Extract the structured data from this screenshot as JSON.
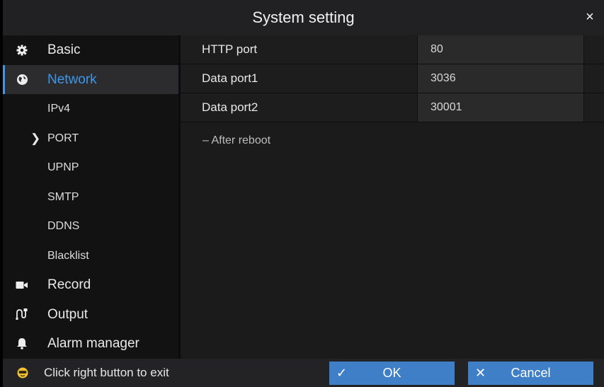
{
  "window": {
    "title": "System setting",
    "close_glyph": "×"
  },
  "sidebar": {
    "items": [
      {
        "label": "Basic",
        "icon": "gear-icon"
      },
      {
        "label": "Network",
        "icon": "globe-icon",
        "active": true
      },
      {
        "label": "IPv4",
        "sub": true
      },
      {
        "label": "PORT",
        "sub": true,
        "selected": true
      },
      {
        "label": "UPNP",
        "sub": true
      },
      {
        "label": "SMTP",
        "sub": true
      },
      {
        "label": "DDNS",
        "sub": true
      },
      {
        "label": "Blacklist",
        "sub": true
      },
      {
        "label": "Record",
        "icon": "camera-icon"
      },
      {
        "label": "Output",
        "icon": "output-icon"
      },
      {
        "label": "Alarm manager",
        "icon": "bell-icon"
      }
    ]
  },
  "content": {
    "rows": [
      {
        "label": "HTTP port",
        "value": "80"
      },
      {
        "label": "Data port1",
        "value": "3036"
      },
      {
        "label": "Data port2",
        "value": "30001"
      }
    ],
    "note": "– After reboot"
  },
  "footer": {
    "hint": "Click right button to exit",
    "hint_icon": "mouse-face-icon",
    "ok_label": "OK",
    "ok_glyph": "✓",
    "cancel_label": "Cancel",
    "cancel_glyph": "✕"
  },
  "colors": {
    "accent": "#3d97e8",
    "button": "#3f7fc8",
    "background": "#1a1a1a"
  }
}
